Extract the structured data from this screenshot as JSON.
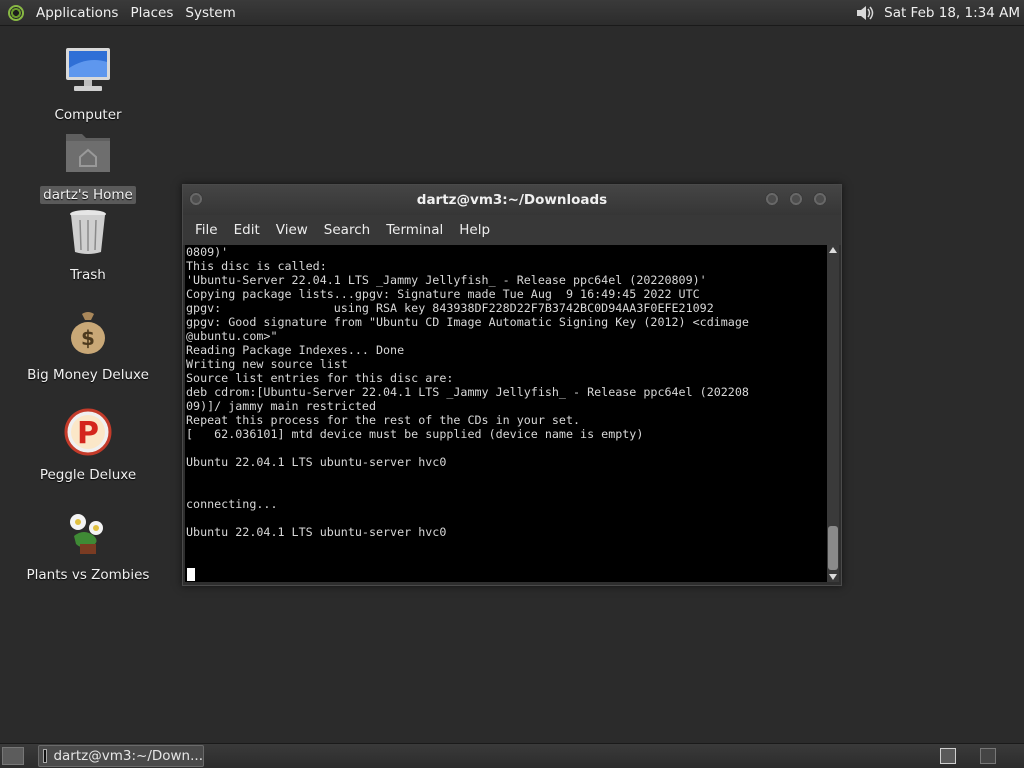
{
  "top_panel": {
    "menus": [
      "Applications",
      "Places",
      "System"
    ],
    "clock": "Sat Feb 18, 1:34 AM",
    "icons": {
      "apps": "gnome-foot-icon",
      "volume": "speaker-icon"
    }
  },
  "desktop": {
    "icons": [
      {
        "label": "Computer",
        "icon": "computer-icon"
      },
      {
        "label": "dartz's Home",
        "icon": "home-folder-icon",
        "selected": true
      },
      {
        "label": "Trash",
        "icon": "trash-icon"
      },
      {
        "label": "Big Money Deluxe",
        "icon": "money-bag-icon"
      },
      {
        "label": "Peggle Deluxe",
        "icon": "peggle-icon"
      },
      {
        "label": "Plants vs Zombies",
        "icon": "plants-icon"
      }
    ]
  },
  "window": {
    "title": "dartz@vm3:~/Downloads",
    "menu": [
      "File",
      "Edit",
      "View",
      "Search",
      "Terminal",
      "Help"
    ],
    "terminal_lines": [
      "0809)'",
      "This disc is called:",
      "'Ubuntu-Server 22.04.1 LTS _Jammy Jellyfish_ - Release ppc64el (20220809)'",
      "Copying package lists...gpgv: Signature made Tue Aug  9 16:49:45 2022 UTC",
      "gpgv:                using RSA key 843938DF228D22F7B3742BC0D94AA3F0EFE21092",
      "gpgv: Good signature from \"Ubuntu CD Image Automatic Signing Key (2012) <cdimage",
      "@ubuntu.com>\"",
      "Reading Package Indexes... Done",
      "Writing new source list",
      "Source list entries for this disc are:",
      "deb cdrom:[Ubuntu-Server 22.04.1 LTS _Jammy Jellyfish_ - Release ppc64el (202208",
      "09)]/ jammy main restricted",
      "Repeat this process for the rest of the CDs in your set.",
      "[   62.036101] mtd device must be supplied (device name is empty)",
      "",
      "Ubuntu 22.04.1 LTS ubuntu-server hvc0",
      "",
      "",
      "connecting...",
      "",
      "Ubuntu 22.04.1 LTS ubuntu-server hvc0"
    ]
  },
  "taskbar": {
    "task_label": "dartz@vm3:~/Down..."
  }
}
